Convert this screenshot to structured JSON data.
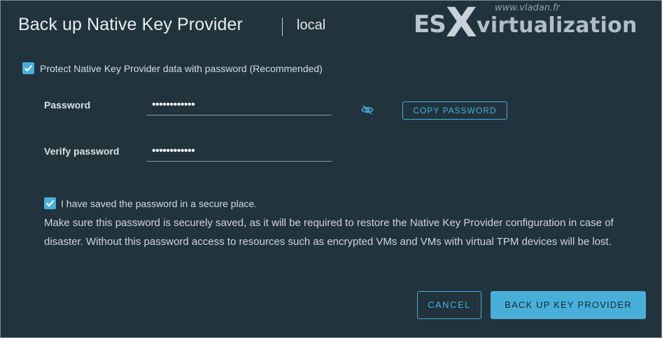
{
  "header": {
    "title": "Back up Native Key Provider",
    "subtitle": "local"
  },
  "watermark": {
    "small": "www.vladan.fr",
    "es": "ES",
    "x": "X",
    "rest": "virtualization"
  },
  "protect": {
    "checked": true,
    "label": "Protect Native Key Provider data with password (Recommended)"
  },
  "password": {
    "label": "Password",
    "value": "••••••••••••",
    "copy_label": "COPY PASSWORD"
  },
  "verify": {
    "label": "Verify password",
    "value": "••••••••••••"
  },
  "saved": {
    "checked": true,
    "label": "I have saved the password in a secure place.",
    "note": "Make sure this password is securely saved, as it will be required to restore the Native Key Provider configuration in case of disaster. Without this password access to resources such as encrypted VMs and VMs with virtual TPM devices will be lost."
  },
  "footer": {
    "cancel_label": "CANCEL",
    "submit_label": "BACK UP KEY PROVIDER"
  },
  "colors": {
    "accent": "#49afd9",
    "background": "#21333d"
  }
}
